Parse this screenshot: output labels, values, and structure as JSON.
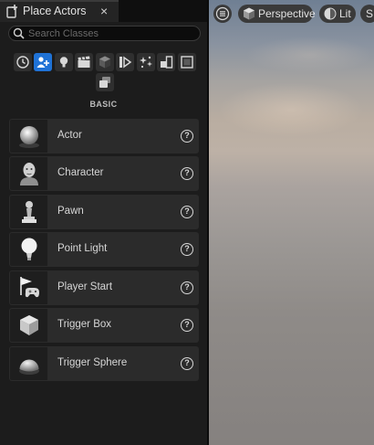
{
  "tab": {
    "title": "Place Actors",
    "close": "×",
    "icon": "place-actors-icon"
  },
  "search": {
    "placeholder": "Search Classes",
    "value": ""
  },
  "categories": [
    {
      "name": "recently-placed",
      "icon": "clock-icon",
      "active": false
    },
    {
      "name": "basic",
      "icon": "person-plus-icon",
      "active": true
    },
    {
      "name": "lights",
      "icon": "lightbulb-icon",
      "active": false
    },
    {
      "name": "cinematic",
      "icon": "clapperboard-icon",
      "active": false
    },
    {
      "name": "visual-effects",
      "icon": "cube-icon",
      "active": false
    },
    {
      "name": "volumes",
      "icon": "play-volume-icon",
      "active": false
    },
    {
      "name": "particles",
      "icon": "sparkle-icon",
      "active": false
    },
    {
      "name": "shapes",
      "icon": "shapes-icon",
      "active": false
    },
    {
      "name": "all-classes",
      "icon": "box-outline-icon",
      "active": false
    },
    {
      "name": "geometry",
      "icon": "layers-icon",
      "active": false
    }
  ],
  "section_title": "BASIC",
  "actors": [
    {
      "label": "Actor",
      "icon": "sphere-icon"
    },
    {
      "label": "Character",
      "icon": "character-bust-icon"
    },
    {
      "label": "Pawn",
      "icon": "pawn-icon"
    },
    {
      "label": "Point Light",
      "icon": "light-bulb-icon"
    },
    {
      "label": "Player Start",
      "icon": "flag-gamepad-icon"
    },
    {
      "label": "Trigger Box",
      "icon": "box-icon"
    },
    {
      "label": "Trigger Sphere",
      "icon": "half-sphere-icon"
    }
  ],
  "help_glyph": "?",
  "viewport": {
    "menu_icon": "hamburger-icon",
    "perspective_label": "Perspective",
    "lit_label": "Lit",
    "truncated_label": "S"
  },
  "colors": {
    "accent": "#1f72d6",
    "panel": "#1c1c1c",
    "item": "#2b2b2b"
  }
}
